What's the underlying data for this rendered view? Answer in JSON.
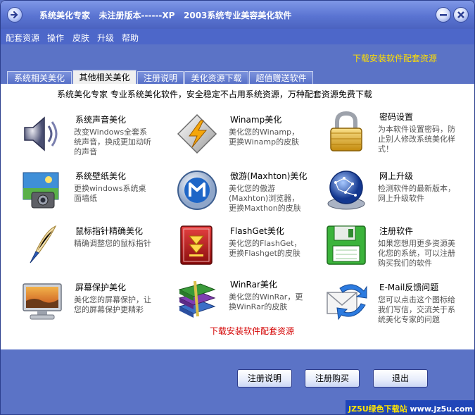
{
  "window": {
    "title": "系统美化专家   未注册版本------XP   2003系统专业美容美化软件"
  },
  "menu": [
    "配套资源",
    "操作",
    "皮肤",
    "升级",
    "帮助"
  ],
  "banner_link": "下载安装软件配套资源",
  "tabs": [
    {
      "label": "系统相关美化",
      "active": false
    },
    {
      "label": "其他相关美化",
      "active": true
    },
    {
      "label": "注册说明",
      "active": false
    },
    {
      "label": "美化资源下载",
      "active": false
    },
    {
      "label": "超值赠送软件",
      "active": false
    }
  ],
  "description": "系统美化专家   专业系统美化软件，安全稳定不占用系统资源，万种配套资源免费下载",
  "items": [
    {
      "title": "系统声音美化",
      "desc": "改变Windows全套系统声音，换成更加动听的声音",
      "icon": "speaker-icon"
    },
    {
      "title": "Winamp美化",
      "desc": "美化您的Winamp，更换Winamp的皮肤",
      "icon": "winamp-icon"
    },
    {
      "title": "密码设置",
      "desc": "为本软件设置密码，防止别人修改系统美化样式！",
      "icon": "padlock-icon"
    },
    {
      "title": "系统壁纸美化",
      "desc": "更换windows系统桌面墙纸",
      "icon": "wallpaper-icon"
    },
    {
      "title": "傲游(Maxhton)美化",
      "desc": "美化您的傲游(Maxhton)浏览器，更换Maxthon的皮肤",
      "icon": "maxthon-icon"
    },
    {
      "title": "网上升级",
      "desc": "检测软件的最新版本，网上升级软件",
      "icon": "globe-icon"
    },
    {
      "title": "鼠标指针精确美化",
      "desc": "精确调整您的鼠标指针",
      "icon": "quill-icon"
    },
    {
      "title": "FlashGet美化",
      "desc": "美化您的FlashGet，更换Flashget的皮肤",
      "icon": "flashget-icon"
    },
    {
      "title": "注册软件",
      "desc": "如果您想用更多资源美化您的系统，可以注册购买我们的软件",
      "icon": "floppy-icon"
    },
    {
      "title": "屏幕保护美化",
      "desc": "美化您的屏幕保护，让您的屏幕保护更精彩",
      "icon": "monitor-icon"
    },
    {
      "title": "WinRar美化",
      "desc": "美化您的WinRar，更换WinRar的皮肤",
      "icon": "winrar-icon"
    },
    {
      "title": "E-Mail反馈问题",
      "desc": "您可以点击这个图标给我们写信，交流关于系统美化专家的问题",
      "icon": "email-icon"
    }
  ],
  "content_link": "下载安装软件配套资源",
  "buttons": {
    "register_info": "注册说明",
    "register_buy": "注册购买",
    "exit": "退出"
  },
  "footer": {
    "brand": "JZ5U绿色下载站",
    "url": "www.jz5u.com"
  },
  "colors": {
    "accent": "#5b73c6",
    "link_yellow": "#ffde00",
    "link_red": "#d40000"
  }
}
